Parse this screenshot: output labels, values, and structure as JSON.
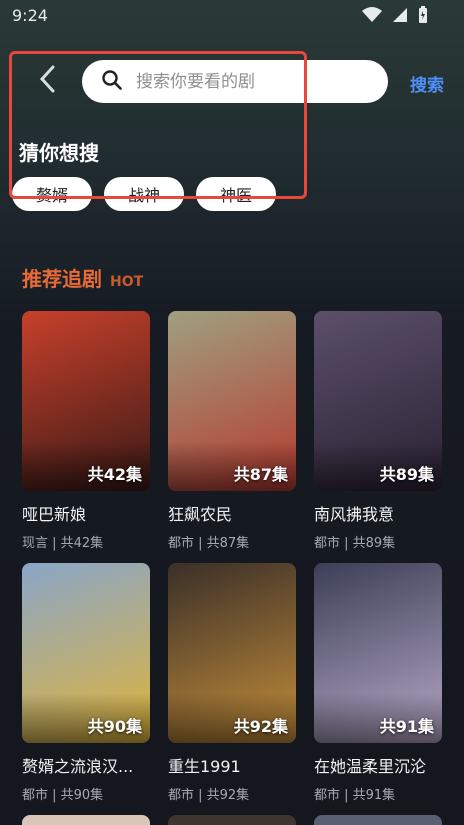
{
  "status": {
    "time": "9:24"
  },
  "search": {
    "placeholder": "搜索你要看的剧",
    "action_label": "搜索"
  },
  "suggestions": {
    "title": "猜你想搜",
    "chips": [
      "赘婿",
      "战神",
      "神医"
    ]
  },
  "section": {
    "title": "推荐追剧",
    "subtitle": "HOT"
  },
  "dramas": [
    {
      "title": "哑巴新娘",
      "meta": "现言 | 共42集",
      "episodes": "共42集",
      "poster_colors": [
        "#c7402b",
        "#3a1a16"
      ]
    },
    {
      "title": "狂飙农民",
      "meta": "都市 | 共87集",
      "episodes": "共87集",
      "poster_colors": [
        "#9fa080",
        "#b63a2f"
      ]
    },
    {
      "title": "南风拂我意",
      "meta": "都市 | 共89集",
      "episodes": "共89集",
      "poster_colors": [
        "#5b4f6a",
        "#2a2233"
      ]
    },
    {
      "title": "赘婿之流浪汉...",
      "meta": "都市 | 共90集",
      "episodes": "共90集",
      "poster_colors": [
        "#8aa6c8",
        "#e0b43a"
      ]
    },
    {
      "title": "重生1991",
      "meta": "都市 | 共92集",
      "episodes": "共92集",
      "poster_colors": [
        "#3a2f28",
        "#c58f3a"
      ]
    },
    {
      "title": "在她温柔里沉沦",
      "meta": "都市 | 共91集",
      "episodes": "共91集",
      "poster_colors": [
        "#3b3f55",
        "#b7a9c9"
      ]
    }
  ],
  "colors": {
    "accent": "#4f8ff7",
    "section": "#e86a36",
    "highlight": "#e8473d"
  }
}
